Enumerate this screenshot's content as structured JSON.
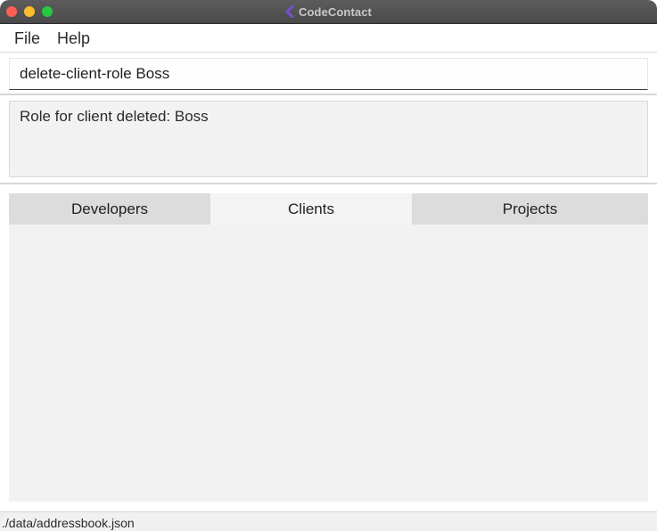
{
  "window": {
    "title": "CodeContact",
    "app_icon": "codecontact-logo-icon"
  },
  "menubar": {
    "file_label": "File",
    "help_label": "Help"
  },
  "command": {
    "value": "delete-client-role Boss"
  },
  "result": {
    "message": "Role for client deleted: Boss"
  },
  "tabs": [
    {
      "label": "Developers",
      "selected": false
    },
    {
      "label": "Clients",
      "selected": true
    },
    {
      "label": "Projects",
      "selected": false
    }
  ],
  "status": {
    "path": "./data/addressbook.json"
  },
  "colors": {
    "titlebar": "#505050",
    "close": "#fe5f57",
    "minimize": "#febc2e",
    "maximize": "#28c840",
    "panel": "#f2f2f2",
    "tab_inactive": "#dcdcdc"
  }
}
